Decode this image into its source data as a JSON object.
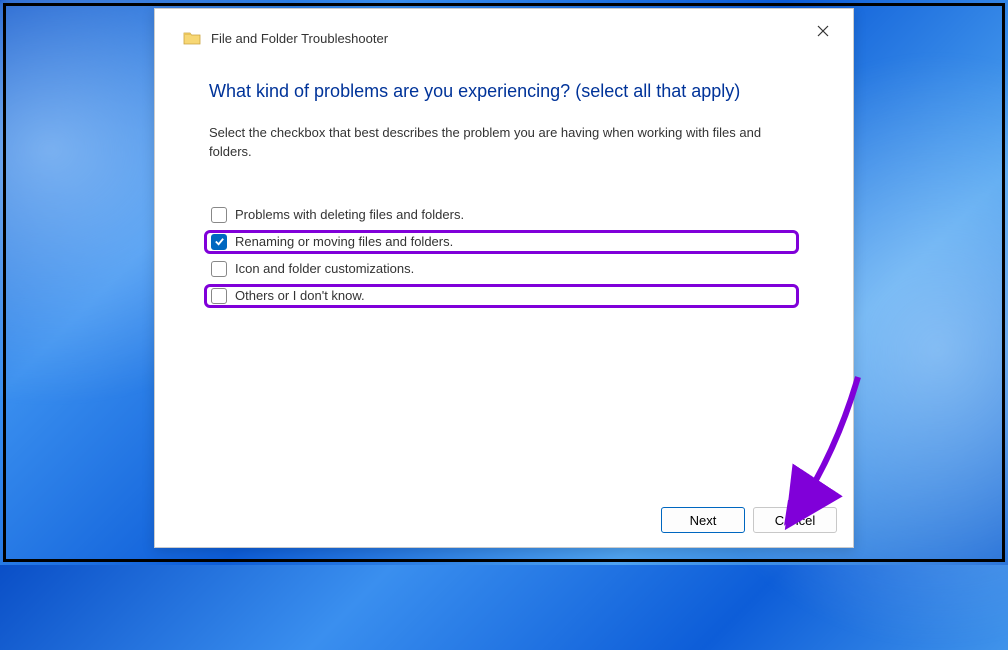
{
  "window": {
    "title": "File and Folder Troubleshooter"
  },
  "content": {
    "heading": "What kind of problems are you experiencing? (select all that apply)",
    "subtext": "Select the checkbox that best describes the problem you are having when working with files and folders."
  },
  "options": [
    {
      "label": "Problems with deleting files and folders.",
      "checked": false,
      "highlighted": false
    },
    {
      "label": "Renaming or moving files and folders.",
      "checked": true,
      "highlighted": true
    },
    {
      "label": "Icon and folder customizations.",
      "checked": false,
      "highlighted": false
    },
    {
      "label": "Others or I don't know.",
      "checked": false,
      "highlighted": true
    }
  ],
  "buttons": {
    "next": "Next",
    "cancel": "Cancel"
  },
  "colors": {
    "highlight": "#8000d9",
    "accent": "#0067c0",
    "heading": "#003399"
  }
}
